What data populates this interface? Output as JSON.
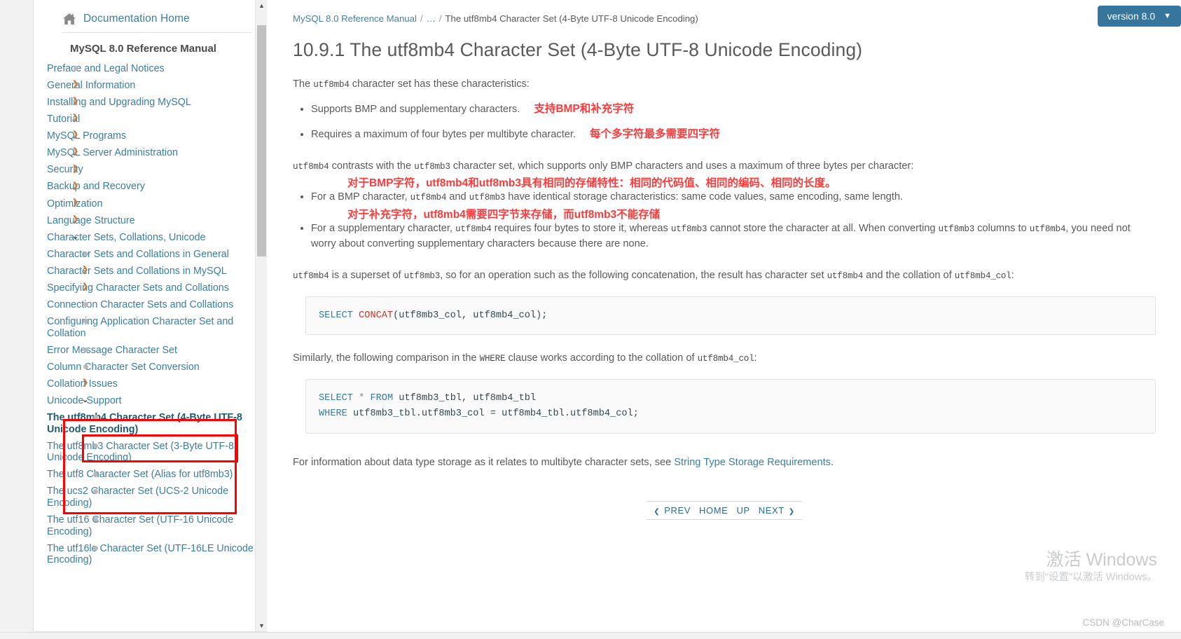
{
  "sidebar": {
    "home_label": "Documentation Home",
    "home_icon": "home-icon",
    "title": "MySQL 8.0 Reference Manual",
    "items": [
      {
        "label": "Preface and Legal Notices",
        "marker": "dot",
        "level": 1
      },
      {
        "label": "General Information",
        "marker": "arrow",
        "level": 1
      },
      {
        "label": "Installing and Upgrading MySQL",
        "marker": "arrow",
        "level": 1
      },
      {
        "label": "Tutorial",
        "marker": "arrow",
        "level": 1
      },
      {
        "label": "MySQL Programs",
        "marker": "arrow",
        "level": 1
      },
      {
        "label": "MySQL Server Administration",
        "marker": "arrow",
        "level": 1
      },
      {
        "label": "Security",
        "marker": "arrow",
        "level": 1
      },
      {
        "label": "Backup and Recovery",
        "marker": "arrow",
        "level": 1
      },
      {
        "label": "Optimization",
        "marker": "arrow",
        "level": 1
      },
      {
        "label": "Language Structure",
        "marker": "arrow",
        "level": 1
      },
      {
        "label": "Character Sets, Collations, Unicode",
        "marker": "caret-down",
        "level": 1
      },
      {
        "label": "Character Sets and Collations in General",
        "marker": "dot",
        "level": 2
      },
      {
        "label": "Character Sets and Collations in MySQL",
        "marker": "arrow",
        "level": 2
      },
      {
        "label": "Specifying Character Sets and Collations",
        "marker": "arrow",
        "level": 2
      },
      {
        "label": "Connection Character Sets and Collations",
        "marker": "dot",
        "level": 2
      },
      {
        "label": "Configuring Application Character Set and Collation",
        "marker": "dot",
        "level": 2
      },
      {
        "label": "Error Message Character Set",
        "marker": "dot",
        "level": 2
      },
      {
        "label": "Column Character Set Conversion",
        "marker": "dot",
        "level": 2
      },
      {
        "label": "Collation Issues",
        "marker": "arrow",
        "level": 2
      },
      {
        "label": "Unicode Support",
        "marker": "caret-down",
        "level": 2
      },
      {
        "label": "The utf8mb4 Character Set (4-Byte UTF-8 Unicode Encoding)",
        "marker": "dot",
        "level": 3,
        "current": true
      },
      {
        "label": "The utf8mb3 Character Set (3-Byte UTF-8 Unicode Encoding)",
        "marker": "dot",
        "level": 3
      },
      {
        "label": "The utf8 Character Set (Alias for utf8mb3)",
        "marker": "dot",
        "level": 3
      },
      {
        "label": "The ucs2 Character Set (UCS-2 Unicode Encoding)",
        "marker": "dot",
        "level": 3
      },
      {
        "label": "The utf16 Character Set (UTF-16 Unicode Encoding)",
        "marker": "dot",
        "level": 3
      },
      {
        "label": "The utf16le Character Set (UTF-16LE Unicode Encoding)",
        "marker": "dot",
        "level": 3
      }
    ],
    "scroll": {
      "up_glyph": "▲",
      "down_glyph": "▼"
    }
  },
  "annotations": {
    "highlight_color": "#ff0000",
    "outer_box_target": "Unicode Support section",
    "inner_box_target": "The utf8mb4 Character Set (4-Byte UTF-8 Unicode Encoding)"
  },
  "header": {
    "breadcrumb": {
      "root": "MySQL 8.0 Reference Manual",
      "ellipsis": "…",
      "current": "The utf8mb4 Character Set (4-Byte UTF-8 Unicode Encoding)",
      "separator": "/"
    },
    "version_button": {
      "label": "version 8.0",
      "caret": "chevron-down-icon",
      "color": "#35759e"
    }
  },
  "main": {
    "title": "10.9.1 The utf8mb4 Character Set (4-Byte UTF-8 Unicode Encoding)",
    "intro_prefix": "The ",
    "intro_code": "utf8mb4",
    "intro_suffix": " character set has these characteristics:",
    "bullets_1": [
      {
        "text": "Supports BMP and supplementary characters.",
        "note": "支持BMP和补充字符"
      },
      {
        "text": "Requires a maximum of four bytes per multibyte character.",
        "note": "每个多字符最多需要四字符"
      }
    ],
    "para_contrast": {
      "c1": "utf8mb4",
      "t1": " contrasts with the ",
      "c2": "utf8mb3",
      "t2": " character set, which supports only BMP characters and uses a maximum of three bytes per character:"
    },
    "bullets_2": [
      {
        "note": "对于BMP字符，utf8mb4和utf8mb3具有相同的存储特性：相同的代码值、相同的编码、相同的长度。",
        "t1": "For a BMP character, ",
        "c1": "utf8mb4",
        "t2": " and ",
        "c2": "utf8mb3",
        "t3": " have identical storage characteristics: same code values, same encoding, same length."
      },
      {
        "note": "对于补充字符，utf8mb4需要四字节来存储，而utf8mb3不能存储",
        "t1": "For a supplementary character, ",
        "c1": "utf8mb4",
        "t2": " requires four bytes to store it, whereas ",
        "c2": "utf8mb3",
        "t3": " cannot store the character at all. When converting ",
        "c3": "utf8mb3",
        "t4": " columns to ",
        "c4": "utf8mb4",
        "t5": ", you need not worry about converting supplementary characters because there are none."
      }
    ],
    "para_superset": {
      "c1": "utf8mb4",
      "t1": " is a superset of ",
      "c2": "utf8mb3",
      "t2": ", so for an operation such as the following concatenation, the result has character set ",
      "c3": "utf8mb4",
      "t3": " and the collation of ",
      "c4": "utf8mb4_col",
      "t4": ":"
    },
    "code_1": {
      "kw": "SELECT",
      "fn": "CONCAT",
      "rest": "(utf8mb3_col, utf8mb4_col);"
    },
    "para_similarly": {
      "t1": "Similarly, the following comparison in the ",
      "c1": "WHERE",
      "t2": " clause works according to the collation of ",
      "c2": "utf8mb4_col",
      "t3": ":"
    },
    "code_2": {
      "line1_kw1": "SELECT",
      "line1_star": "*",
      "line1_kw2": "FROM",
      "line1_rest": "utf8mb3_tbl, utf8mb4_tbl",
      "line2_kw": "WHERE",
      "line2_rest": "utf8mb3_tbl.utf8mb3_col = utf8mb4_tbl.utf8mb4_col;"
    },
    "para_storage": {
      "t1": "For information about data type storage as it relates to multibyte character sets, see ",
      "link": "String Type Storage Requirements",
      "t2": "."
    },
    "footer_nav": {
      "prev": "PREV",
      "home": "HOME",
      "up": "UP",
      "next": "NEXT",
      "left_chev": "❮",
      "right_chev": "❯"
    }
  },
  "watermark": {
    "line1": "激活 Windows",
    "line2": "转到\"设置\"以激活 Windows。",
    "credit": "CSDN @CharCase"
  }
}
